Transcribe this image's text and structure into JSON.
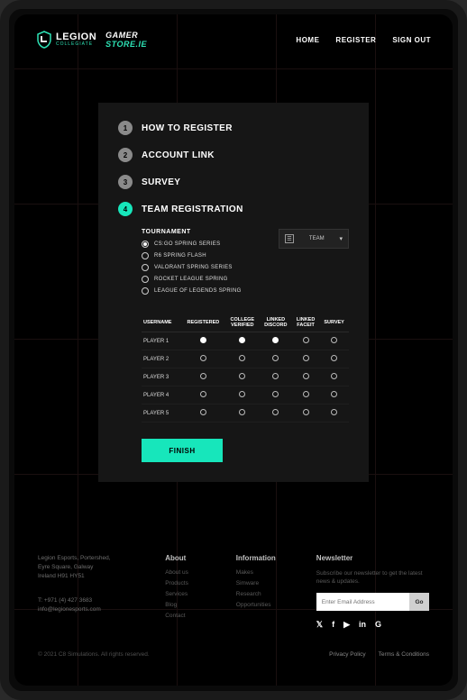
{
  "brand": {
    "legion_name": "LEGION",
    "legion_sub": "COLLEGIATE",
    "gamer_left": "GAMER",
    "gamer_right": "STORE.IE"
  },
  "nav": {
    "home": "HOME",
    "register": "REGISTER",
    "signout": "SIGN OUT"
  },
  "steps": [
    {
      "num": "1",
      "label": "HOW TO REGISTER",
      "active": false
    },
    {
      "num": "2",
      "label": "ACCOUNT LINK",
      "active": false
    },
    {
      "num": "3",
      "label": "SURVEY",
      "active": false
    },
    {
      "num": "4",
      "label": "TEAM REGISTRATION",
      "active": true
    }
  ],
  "form": {
    "tournament_label": "TOURNAMENT",
    "tournaments": [
      {
        "label": "CS:GO SPRING SERIES",
        "selected": true
      },
      {
        "label": "R6 SPRING FLASH",
        "selected": false
      },
      {
        "label": "VALORANT SPRING SERIES",
        "selected": false
      },
      {
        "label": "ROCKET LEAGUE SPRING",
        "selected": false
      },
      {
        "label": "LEAGUE OF LEGENDS SPRING",
        "selected": false
      }
    ],
    "team_icon": "☰",
    "team_label": "TEAM",
    "table_headers": [
      "USERNAME",
      "REGISTERED",
      "COLLEGE VERIFIED",
      "LINKED DISCORD",
      "LINKED FACEIT",
      "SURVEY"
    ],
    "rows": [
      {
        "name": "PLAYER 1",
        "cells": [
          true,
          true,
          true,
          false,
          false
        ]
      },
      {
        "name": "PLAYER 2",
        "cells": [
          false,
          false,
          false,
          false,
          false
        ]
      },
      {
        "name": "PLAYER 3",
        "cells": [
          false,
          false,
          false,
          false,
          false
        ]
      },
      {
        "name": "PLAYER 4",
        "cells": [
          false,
          false,
          false,
          false,
          false
        ]
      },
      {
        "name": "PLAYER 5",
        "cells": [
          false,
          false,
          false,
          false,
          false
        ]
      }
    ],
    "finish_label": "FINISH"
  },
  "footer": {
    "address": [
      "Legion Esports, Portershed,",
      "Eyre Square, Galway",
      "Ireland H91 HY51"
    ],
    "phone": "T: +971 (4) 427 3683",
    "email": "info@legionesports.com",
    "about_title": "About",
    "about_links": [
      "About us",
      "Products",
      "Services",
      "Blog",
      "Contact"
    ],
    "info_title": "Information",
    "info_links": [
      "Makes",
      "Simware",
      "Research",
      "Opportunities"
    ],
    "news_title": "Newsletter",
    "news_desc": "Subscribe our newsletter to get the latest news & updates.",
    "news_placeholder": "Enter Email Address",
    "news_go": "Go",
    "socials": [
      "twitter",
      "facebook",
      "youtube",
      "linkedin",
      "google"
    ]
  },
  "bottom": {
    "copy": "© 2021 C8 Simulations. All rights reserved.",
    "privacy": "Privacy Policy",
    "terms": "Terms & Conditions"
  }
}
